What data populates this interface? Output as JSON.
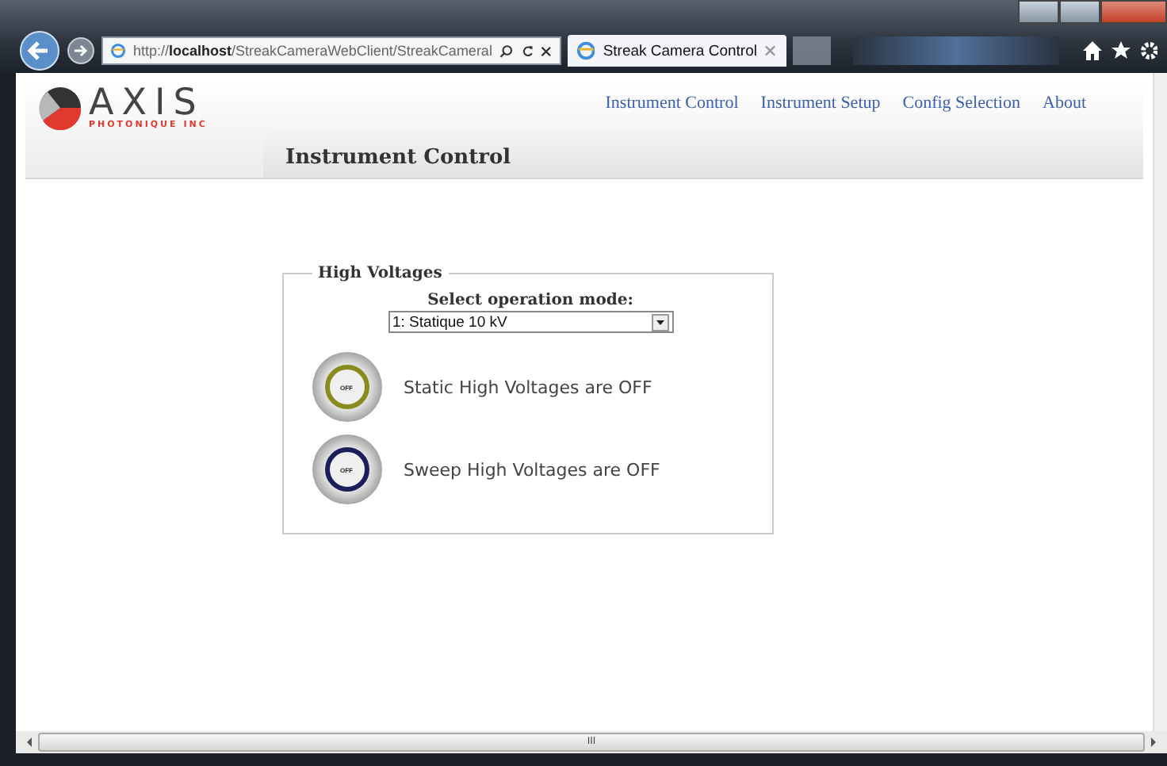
{
  "browser": {
    "address": "http://**localhost**/StreakCameraWebClient/StreakCameral",
    "tab_title": "Streak Camera Control"
  },
  "logo": {
    "name": "AXIS",
    "tagline": "PHOTONIQUE INC"
  },
  "nav": [
    {
      "label": "Instrument Control"
    },
    {
      "label": "Instrument Setup"
    },
    {
      "label": "Config Selection"
    },
    {
      "label": "About"
    }
  ],
  "page_title": "Instrument Control",
  "panel": {
    "legend": "High Voltages",
    "mode_label": "Select operation mode:",
    "mode_value": "1: Statique 10 kV",
    "switches": [
      {
        "button_label": "OFF",
        "color": "#8a8a1e",
        "status": "Static High Voltages are OFF"
      },
      {
        "button_label": "OFF",
        "color": "#1a1f5c",
        "status": "Sweep High Voltages are OFF"
      }
    ]
  },
  "scrollbar_mark": "III"
}
